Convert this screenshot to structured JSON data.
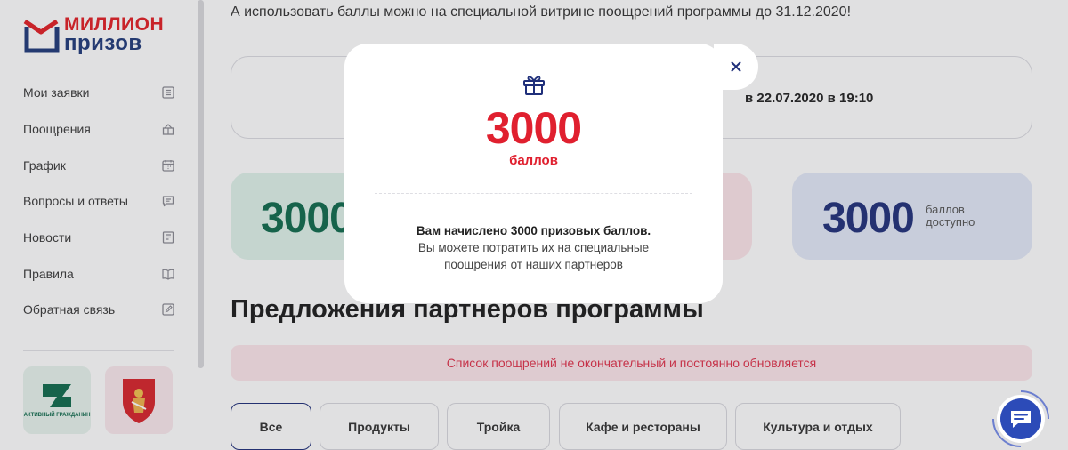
{
  "brand": {
    "line1": "МИЛЛИОН",
    "line2": "призов",
    "colors": {
      "red": "#e31e24",
      "navy": "#1f3a7a"
    }
  },
  "sidebar": {
    "items": [
      {
        "label": "Мои заявки",
        "icon": "list-icon"
      },
      {
        "label": "Поощрения",
        "icon": "gift-outline-icon"
      },
      {
        "label": "График",
        "icon": "calendar-icon"
      },
      {
        "label": "Вопросы и ответы",
        "icon": "chat-bubble-icon"
      },
      {
        "label": "Новости",
        "icon": "news-icon"
      },
      {
        "label": "Правила",
        "icon": "book-icon"
      },
      {
        "label": "Обратная связь",
        "icon": "edit-icon"
      }
    ],
    "partners": [
      {
        "name": "Активный гражданин",
        "logo_text": "АКТИВНЫЙ ГРАЖДАНИН",
        "icon": "active-citizen-logo"
      },
      {
        "name": "Москва",
        "icon": "moscow-coat-of-arms-logo"
      }
    ]
  },
  "main": {
    "intro_text": "А использовать баллы можно на специальной витрине поощрений программы до 31.12.2020!",
    "dates_text": "в 22.07.2020 в 19:10",
    "stats": [
      {
        "value": "3000",
        "caption": ""
      },
      {
        "value": "",
        "caption": ""
      },
      {
        "value": "3000",
        "caption_line1": "баллов",
        "caption_line2": "доступно"
      }
    ],
    "section_title": "Предложения партнеров программы",
    "notice": "Список поощрений не окончательный и постоянно обновляется",
    "tabs": [
      {
        "label": "Все",
        "active": true
      },
      {
        "label": "Продукты",
        "active": false
      },
      {
        "label": "Тройка",
        "active": false
      },
      {
        "label": "Кафе и рестораны",
        "active": false
      },
      {
        "label": "Культура и отдых",
        "active": false
      }
    ]
  },
  "modal": {
    "icon": "gift-icon",
    "amount": "3000",
    "unit": "баллов",
    "message_bold": "Вам начислено 3000 призовых баллов.",
    "message_line2": "Вы можете потратить их на специальные",
    "message_line3": "поощрения от наших партнеров",
    "close_icon": "close-icon"
  },
  "chat_fab": {
    "icon": "chat-icon"
  },
  "colors": {
    "accent_red": "#e0202f",
    "navy": "#1f2f7a",
    "green": "#0f6b4d",
    "notice_bg": "#fde6eb"
  }
}
